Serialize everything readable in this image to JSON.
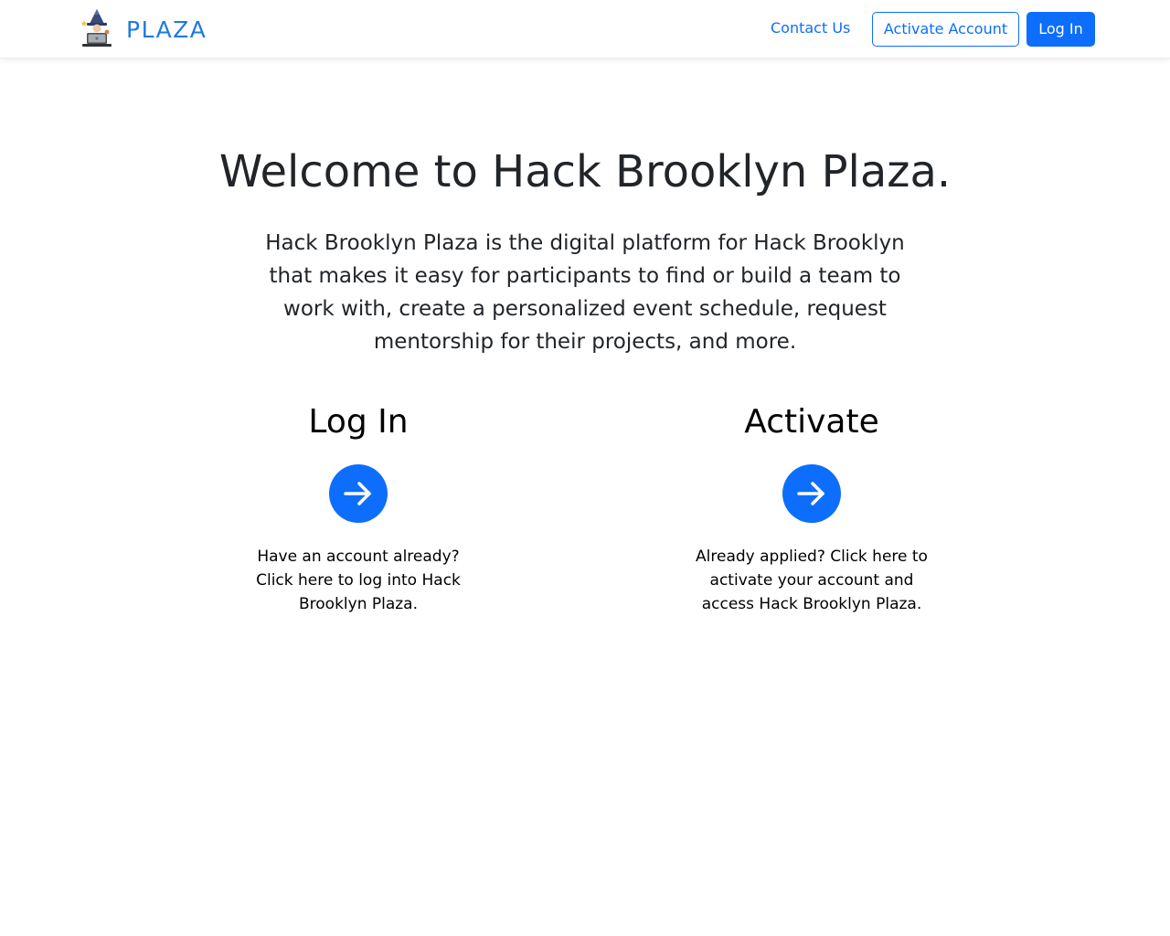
{
  "navbar": {
    "brand_text": "PLAZA",
    "links": {
      "contact": "Contact Us",
      "activate": "Activate Account",
      "login": "Log In"
    }
  },
  "hero": {
    "title": "Welcome to Hack Brooklyn Plaza.",
    "lead": "Hack Brooklyn Plaza is the digital platform for Hack Brooklyn that makes it easy for participants to find or build a team to work with, create a personalized event schedule, request mentorship for their projects, and more."
  },
  "cards": {
    "login": {
      "title": "Log In",
      "icon": "arrow-right-icon",
      "description": "Have an account already? Click here to log into Hack Brooklyn Plaza."
    },
    "activate": {
      "title": "Activate",
      "icon": "arrow-right-icon",
      "description": "Already applied? Click here to activate your account and access Hack Brooklyn Plaza."
    }
  },
  "colors": {
    "primary": "#0d6efd",
    "brand": "#1f7ae0",
    "text": "#212529"
  }
}
